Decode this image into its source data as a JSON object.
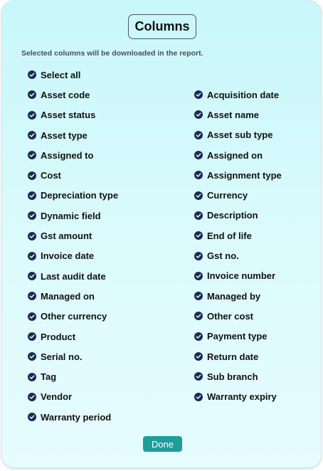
{
  "dialog": {
    "title": "Columns",
    "subtitle": "Selected columns will be downloaded in the report.",
    "done_label": "Done",
    "check_color": "#1c2a57",
    "button_color": "#1e9d9a"
  },
  "left_options": [
    {
      "label": "Select all",
      "checked": true
    },
    {
      "label": "Asset code",
      "checked": true
    },
    {
      "label": "Asset status",
      "checked": true
    },
    {
      "label": "Asset type",
      "checked": true
    },
    {
      "label": "Assigned to",
      "checked": true
    },
    {
      "label": "Cost",
      "checked": true
    },
    {
      "label": "Depreciation type",
      "checked": true
    },
    {
      "label": "Dynamic field",
      "checked": true
    },
    {
      "label": "Gst amount",
      "checked": true
    },
    {
      "label": "Invoice date",
      "checked": true
    },
    {
      "label": "Last audit date",
      "checked": true
    },
    {
      "label": "Managed on",
      "checked": true
    },
    {
      "label": "Other currency",
      "checked": true
    },
    {
      "label": "Product",
      "checked": true
    },
    {
      "label": "Serial no.",
      "checked": true
    },
    {
      "label": "Tag",
      "checked": true
    },
    {
      "label": "Vendor",
      "checked": true
    },
    {
      "label": "Warranty period",
      "checked": true
    }
  ],
  "right_options": [
    {
      "label": "Acquisition date",
      "checked": true
    },
    {
      "label": "Asset name",
      "checked": true
    },
    {
      "label": "Asset sub type",
      "checked": true
    },
    {
      "label": "Assigned on",
      "checked": true
    },
    {
      "label": "Assignment type",
      "checked": true
    },
    {
      "label": "Currency",
      "checked": true
    },
    {
      "label": "Description",
      "checked": true
    },
    {
      "label": "End of life",
      "checked": true
    },
    {
      "label": "Gst no.",
      "checked": true
    },
    {
      "label": "Invoice number",
      "checked": true
    },
    {
      "label": "Managed by",
      "checked": true
    },
    {
      "label": "Other cost",
      "checked": true
    },
    {
      "label": "Payment type",
      "checked": true
    },
    {
      "label": "Return date",
      "checked": true
    },
    {
      "label": "Sub branch",
      "checked": true
    },
    {
      "label": "Warranty expiry",
      "checked": true
    }
  ]
}
